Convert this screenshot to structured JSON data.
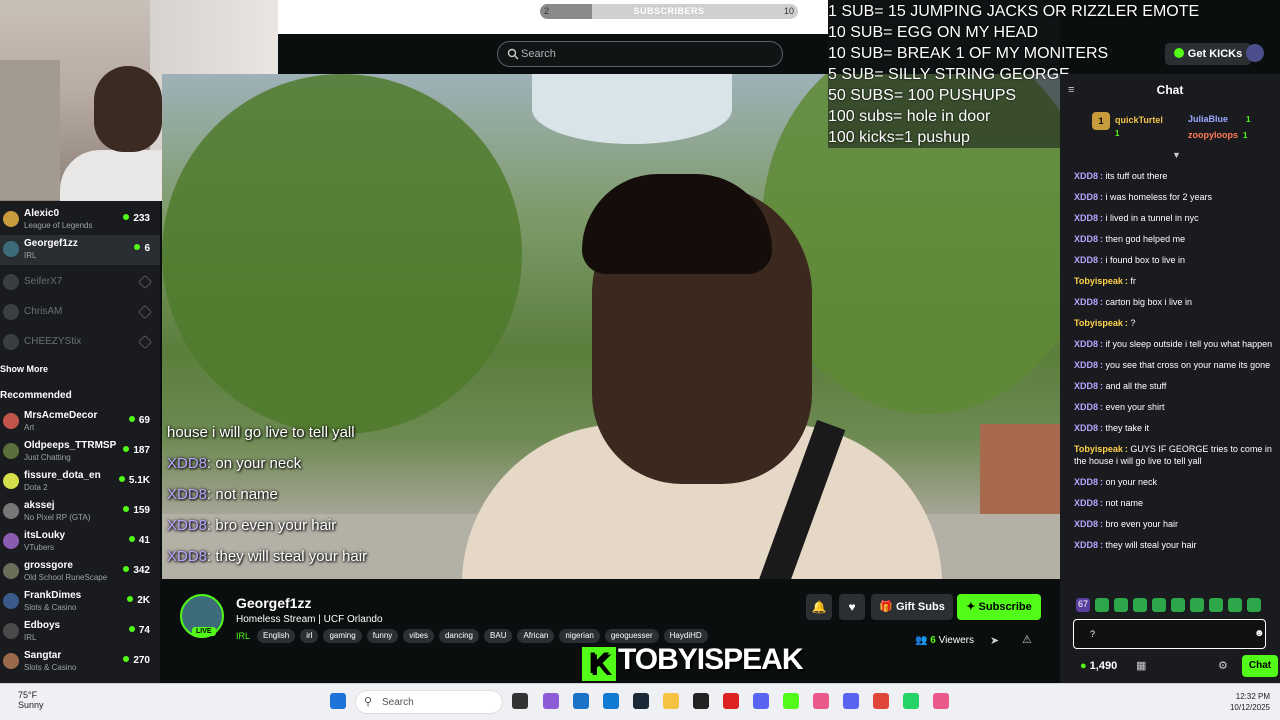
{
  "top_progress": {
    "min": "2",
    "label": "SUBSCRIBERS",
    "max": "10",
    "fill_fraction": 0.2
  },
  "goals": [
    "1 SUB= 15 JUMPING JACKS OR RIZZLER EMOTE",
    "10 SUB= EGG ON MY HEAD",
    "10 SUB= BREAK 1 OF MY MONITERS",
    "5 SUB= SILLY STRING GEORGE",
    "50 SUBS= 100 PUSHUPS",
    "100 subs= hole in door",
    "100 kicks=1 pushup"
  ],
  "header": {
    "search_placeholder": "Search",
    "get_kicks": "Get KICKs"
  },
  "sidebar": {
    "following": [
      {
        "name": "Alexic0",
        "category": "League of Legends",
        "viewers": "233",
        "online": true
      },
      {
        "name": "Georgef1zz",
        "category": "IRL",
        "viewers": "6",
        "online": true,
        "selected": true
      },
      {
        "name": "SeiferX7",
        "category": "",
        "viewers": "",
        "online": false
      },
      {
        "name": "ChrisAM",
        "category": "",
        "viewers": "",
        "online": false
      },
      {
        "name": "CHEEZYStix",
        "category": "",
        "viewers": "",
        "online": false
      }
    ],
    "show_more": "Show More",
    "recommended_title": "Recommended",
    "recommended": [
      {
        "name": "MrsAcmeDecor",
        "category": "Art",
        "viewers": "69"
      },
      {
        "name": "Oldpeeps_TTRMSP",
        "category": "Just Chatting",
        "viewers": "187"
      },
      {
        "name": "fissure_dota_en",
        "category": "Dota 2",
        "viewers": "5.1K"
      },
      {
        "name": "akssej",
        "category": "No Pixel RP (GTA)",
        "viewers": "159"
      },
      {
        "name": "itsLouky",
        "category": "VTubers",
        "viewers": "41"
      },
      {
        "name": "grossgore",
        "category": "Old School RuneScape",
        "viewers": "342"
      },
      {
        "name": "FrankDimes",
        "category": "Slots & Casino",
        "viewers": "2K"
      },
      {
        "name": "Edboys",
        "category": "IRL",
        "viewers": "74"
      },
      {
        "name": "Sangtar",
        "category": "Slots & Casino",
        "viewers": "270"
      }
    ]
  },
  "video_overlay": [
    {
      "user": "",
      "text": "house i will go live to tell yall"
    },
    {
      "user": "XDD8",
      "text": ": on your neck"
    },
    {
      "user": "XDD8",
      "text": ": not name"
    },
    {
      "user": "XDD8",
      "text": ": bro even your hair"
    },
    {
      "user": "XDD8",
      "text": ": they will steal your hair"
    }
  ],
  "stream": {
    "live_badge": "LIVE",
    "channel": "Georgef1zz",
    "title": "Homeless Stream | UCF Orlando",
    "category": "IRL",
    "tags": [
      "English",
      "irl",
      "gaming",
      "funny",
      "vibes",
      "dancing",
      "BAU",
      "African",
      "nigerian",
      "geoguesser",
      "HaydiHD"
    ],
    "gift_subs": "Gift Subs",
    "subscribe": "Subscribe",
    "viewers_count": "6",
    "viewers_label": "Viewers",
    "logo_text": "TOBYISPEAK",
    "logo_k": "K"
  },
  "chat": {
    "title": "Chat",
    "leaderboard": [
      {
        "rank": "1",
        "name": "quickTurtel",
        "count": "1",
        "color": "#f3c14b"
      },
      {
        "name": "JuliaBlue",
        "count": "1",
        "color": "#9aa7ff"
      },
      {
        "name": "zoopyloops",
        "count": "1",
        "color": "#ff7a5a"
      }
    ],
    "messages": [
      {
        "user": "XDD8",
        "color": "#b6a6ff",
        "text": "its tuff out there"
      },
      {
        "user": "XDD8",
        "color": "#b6a6ff",
        "text": "i was homeless for 2 years"
      },
      {
        "user": "XDD8",
        "color": "#b6a6ff",
        "text": "i lived in a tunnel in nyc"
      },
      {
        "user": "XDD8",
        "color": "#b6a6ff",
        "text": "then god helped me"
      },
      {
        "user": "XDD8",
        "color": "#b6a6ff",
        "text": "i found box to live in"
      },
      {
        "user": "Tobyispeak",
        "color": "#ffd24a",
        "text": "fr"
      },
      {
        "user": "XDD8",
        "color": "#b6a6ff",
        "text": "carton big box i live in"
      },
      {
        "user": "Tobyispeak",
        "color": "#ffd24a",
        "text": "?"
      },
      {
        "user": "XDD8",
        "color": "#b6a6ff",
        "text": "if you sleep outside i tell you what happen"
      },
      {
        "user": "XDD8",
        "color": "#b6a6ff",
        "text": "you see that cross on your name its gone"
      },
      {
        "user": "XDD8",
        "color": "#b6a6ff",
        "text": "and all the stuff"
      },
      {
        "user": "XDD8",
        "color": "#b6a6ff",
        "text": "even your shirt"
      },
      {
        "user": "XDD8",
        "color": "#b6a6ff",
        "text": "they take it"
      },
      {
        "user": "Tobyispeak",
        "color": "#ffd24a",
        "text": "GUYS IF GEORGE tries to come in the house i will go live to tell yall"
      },
      {
        "user": "XDD8",
        "color": "#b6a6ff",
        "text": "on your neck"
      },
      {
        "user": "XDD8",
        "color": "#b6a6ff",
        "text": "not name"
      },
      {
        "user": "XDD8",
        "color": "#b6a6ff",
        "text": "bro even your hair"
      },
      {
        "user": "XDD8",
        "color": "#b6a6ff",
        "text": "they will steal your hair"
      }
    ],
    "emote_count": "67",
    "input_value": "?",
    "points": "1,490",
    "send": "Chat"
  },
  "taskbar": {
    "temp": "75°F",
    "weather": "Sunny",
    "search": "Search",
    "time": "12:32 PM",
    "date": "10/12/2025"
  },
  "colors": {
    "accent": "#53fc18",
    "bg": "#0b0e0f",
    "panel": "#191b1f"
  }
}
